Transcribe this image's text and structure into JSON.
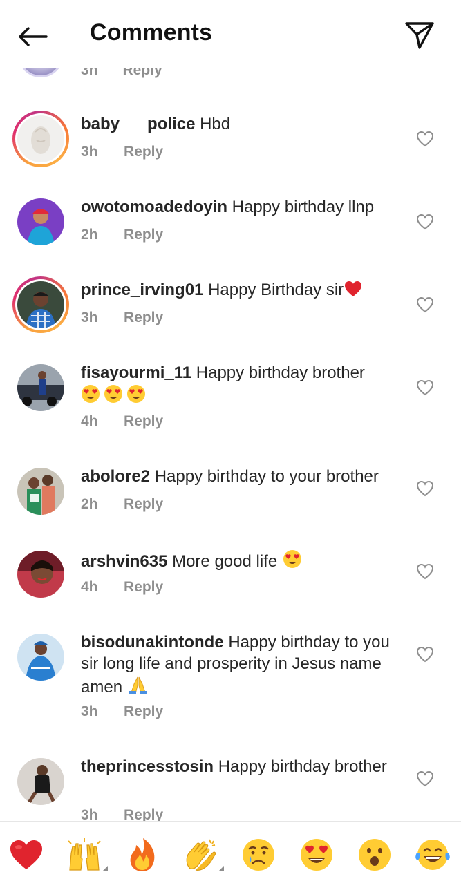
{
  "header": {
    "title": "Comments",
    "back_icon": "arrow-left-icon",
    "share_icon": "paper-plane-icon"
  },
  "partial_comment": {
    "time": "3h",
    "reply": "Reply"
  },
  "comments": [
    {
      "username": "baby___police",
      "text": "Hbd",
      "time": "3h",
      "reply": "Reply",
      "story_ring": true,
      "avatar_icon": "avatar-icon"
    },
    {
      "username": "owotomoadedoyin",
      "text": "Happy birthday llnp",
      "time": "2h",
      "reply": "Reply",
      "story_ring": false,
      "avatar_icon": "avatar-icon"
    },
    {
      "username": "prince_irving01",
      "text": "Happy Birthday sir",
      "emoji": "red-heart-emoji",
      "time": "3h",
      "reply": "Reply",
      "story_ring": true,
      "avatar_icon": "avatar-icon"
    },
    {
      "username": "fisayourmi_11",
      "text": "Happy birthday brother",
      "emoji": "heart-eyes-emoji x3",
      "time": "4h",
      "reply": "Reply",
      "story_ring": false,
      "avatar_icon": "avatar-icon"
    },
    {
      "username": "abolore2",
      "text": "Happy birthday to your brother",
      "time": "2h",
      "reply": "Reply",
      "story_ring": false,
      "avatar_icon": "avatar-icon"
    },
    {
      "username": "arshvin635",
      "text": "More good life",
      "emoji": "heart-eyes-emoji",
      "time": "4h",
      "reply": "Reply",
      "story_ring": false,
      "avatar_icon": "avatar-icon"
    },
    {
      "username": "bisodunakintonde",
      "text": "Happy birthday to you sir long life and prosperity in Jesus name amen",
      "emoji": "folded-hands-emoji",
      "time": "3h",
      "reply": "Reply",
      "story_ring": false,
      "avatar_icon": "avatar-icon"
    },
    {
      "username": "theprincesstosin",
      "text": "Happy birthday brother",
      "time": "3h",
      "reply": "Reply",
      "story_ring": false,
      "avatar_icon": "avatar-icon"
    }
  ],
  "emoji_bar": [
    {
      "name": "red-heart-emoji",
      "has_variants": false
    },
    {
      "name": "raising-hands-emoji",
      "has_variants": true
    },
    {
      "name": "fire-emoji",
      "has_variants": false
    },
    {
      "name": "clapping-hands-emoji",
      "has_variants": true
    },
    {
      "name": "crying-face-emoji",
      "has_variants": false
    },
    {
      "name": "heart-eyes-emoji",
      "has_variants": false
    },
    {
      "name": "surprised-face-emoji",
      "has_variants": false
    },
    {
      "name": "tears-of-joy-emoji",
      "has_variants": false
    }
  ],
  "colors": {
    "text_primary": "#262626",
    "text_secondary": "#8e8e8e",
    "story_ring": "#e1306c",
    "heart_red": "#e0242e"
  }
}
